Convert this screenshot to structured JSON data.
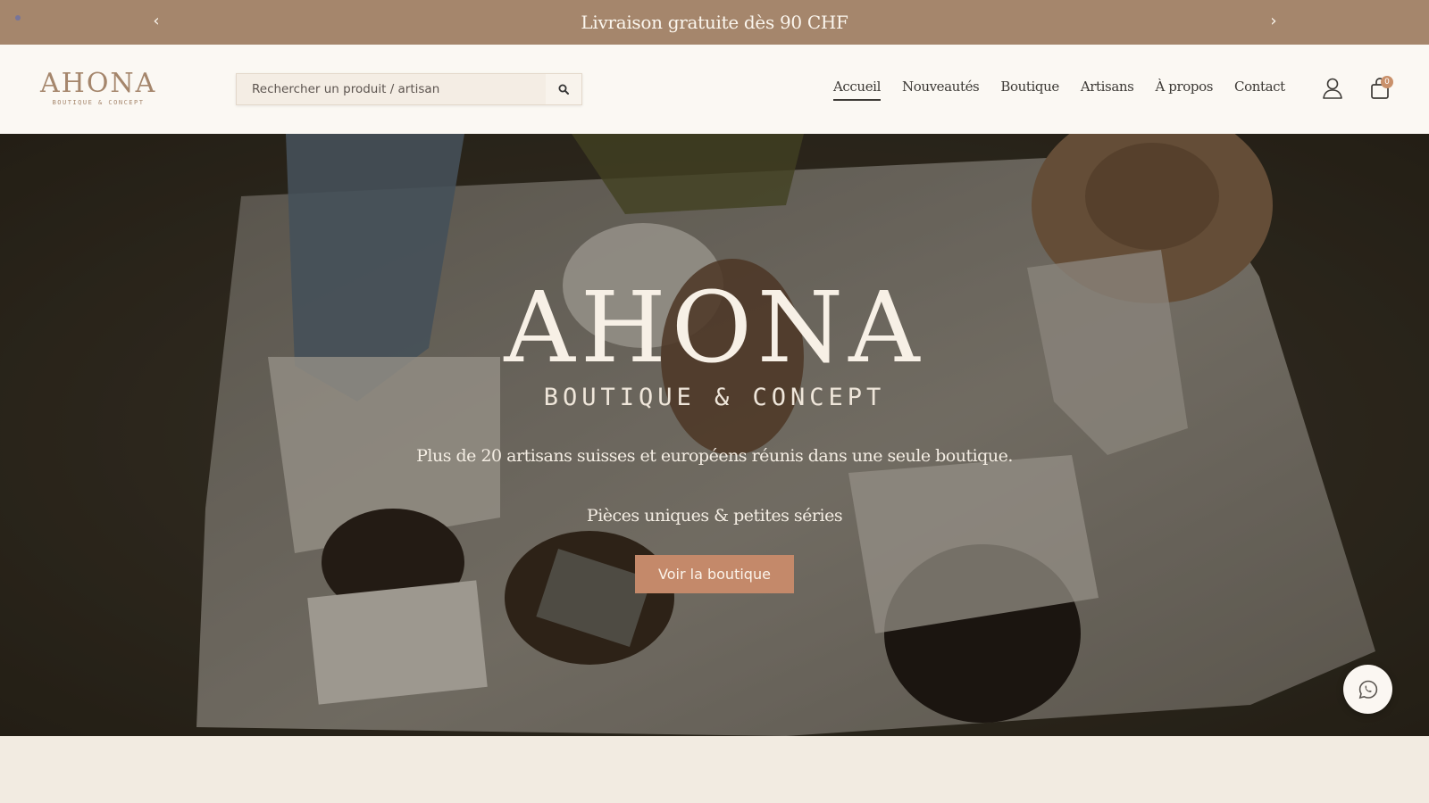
{
  "announcement": {
    "text": "Livraison gratuite dès 90 CHF",
    "prev_icon": "chevron-left-icon",
    "next_icon": "chevron-right-icon"
  },
  "header": {
    "logo": {
      "name": "AHONA",
      "tagline": "BOUTIQUE & CONCEPT"
    },
    "search": {
      "placeholder": "Rechercher un produit / artisan",
      "icon": "search-icon"
    },
    "nav": [
      {
        "label": "Accueil",
        "active": true
      },
      {
        "label": "Nouveautés",
        "active": false
      },
      {
        "label": "Boutique",
        "active": false
      },
      {
        "label": "Artisans",
        "active": false
      },
      {
        "label": "À propos",
        "active": false
      },
      {
        "label": "Contact",
        "active": false
      }
    ],
    "account_icon": "user-icon",
    "cart": {
      "icon": "shopping-bag-icon",
      "count": "0"
    }
  },
  "hero": {
    "title": "AHONA",
    "subtitle": "BOUTIQUE & CONCEPT",
    "text": "Plus de 20 artisans suisses et européens réunis dans une seule boutique.",
    "text2": "Pièces uniques & petites séries",
    "button_label": "Voir la boutique"
  },
  "floating": {
    "whatsapp_icon": "whatsapp-icon"
  },
  "colors": {
    "announcement_bg": "#a5866c",
    "accent": "#c4896a",
    "page_bg": "#f2ebe1",
    "header_bg": "#fbf8f3"
  }
}
